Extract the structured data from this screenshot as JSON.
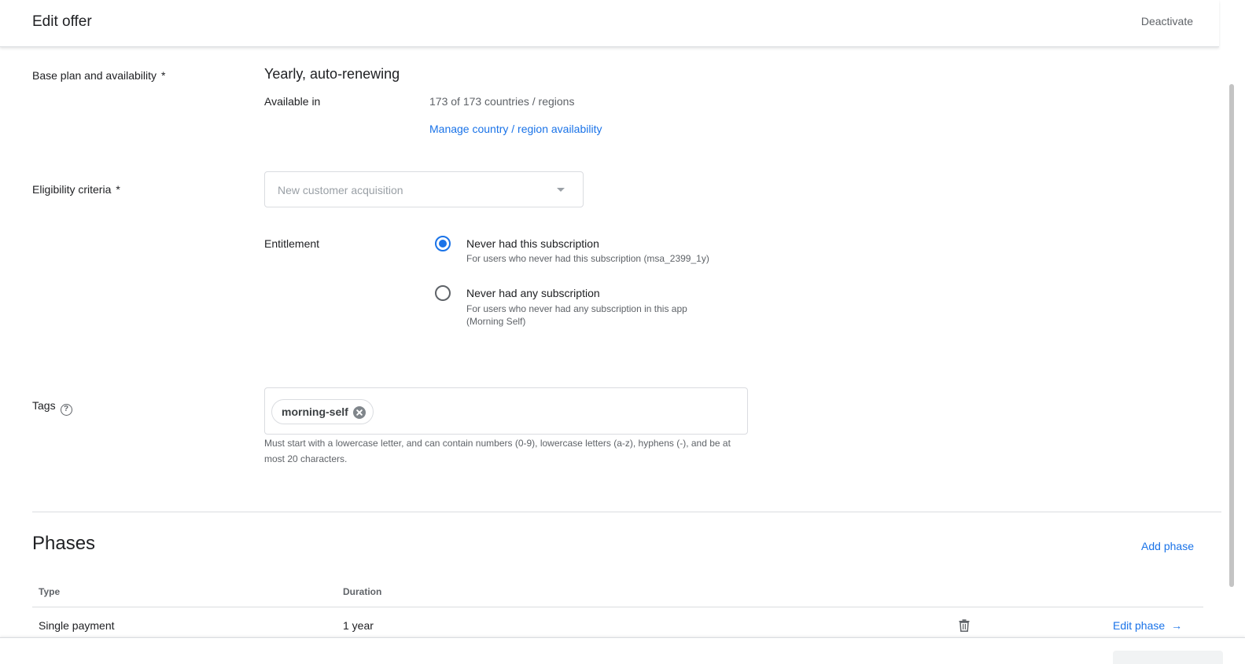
{
  "header": {
    "title": "Edit offer",
    "deactivate_label": "Deactivate"
  },
  "base_plan": {
    "label": "Base plan and availability",
    "required_mark": "*",
    "plan_name": "Yearly, auto-renewing",
    "available_label": "Available in",
    "available_value": "173 of 173 countries / regions",
    "manage_link": "Manage country / region availability"
  },
  "eligibility": {
    "label": "Eligibility criteria",
    "required_mark": "*",
    "select_value": "New customer acquisition",
    "entitlement_label": "Entitlement",
    "options": [
      {
        "title": "Never had this subscription",
        "description": "For users who never had this subscription (msa_2399_1y)",
        "selected": true
      },
      {
        "title": "Never had any subscription",
        "description": "For users who never had any subscription in this app (Morning Self)",
        "selected": false
      }
    ]
  },
  "tags": {
    "label": "Tags",
    "help_icon": "help-circle-icon",
    "chips": [
      "morning-self"
    ],
    "help_text": "Must start with a lowercase letter, and can contain numbers (0-9), lowercase letters (a-z), hyphens (-), and be at most 20 characters."
  },
  "phases": {
    "title": "Phases",
    "add_label": "Add phase",
    "columns": [
      "Type",
      "Duration"
    ],
    "rows": [
      {
        "type": "Single payment",
        "duration": "1 year",
        "delete_icon": "trash-icon",
        "edit_label": "Edit phase",
        "edit_icon": "arrow-right-icon"
      }
    ]
  },
  "colors": {
    "accent": "#1a73e8",
    "text": "#202124",
    "muted": "#5f6368",
    "border": "#dadce0"
  }
}
